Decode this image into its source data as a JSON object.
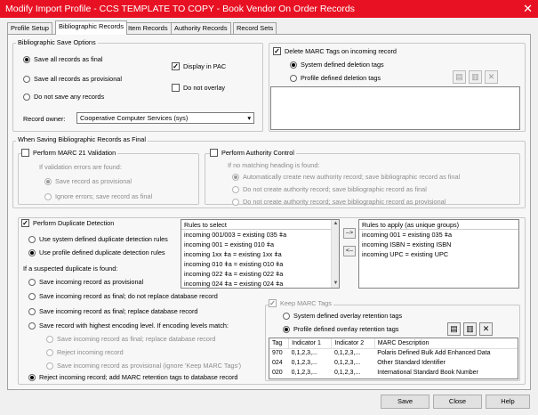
{
  "window": {
    "title": "Modify Import Profile - CCS TEMPLATE TO COPY - Book Vendor On Order Records",
    "close": "✕"
  },
  "tabs": [
    "Profile Setup",
    "Bibliographic Records",
    "Item Records",
    "Authority Records",
    "Record Sets"
  ],
  "save_options": {
    "legend": "Bibliographic Save Options",
    "opt_final": "Save all records as final",
    "opt_prov": "Save all records as provisional",
    "opt_none": "Do not save any records",
    "display_pac": "Display in PAC",
    "no_overlay": "Do not overlay",
    "owner_label": "Record owner:",
    "owner_value": "Cooperative Computer Services (sys)"
  },
  "delete_marc": {
    "label": "Delete MARC Tags on incoming record",
    "sys": "System defined deletion tags",
    "prof": "Profile defined deletion tags"
  },
  "final_section": {
    "legend": "When Saving Bibliographic Records as Final"
  },
  "marc21": {
    "label": "Perform MARC 21 Validation",
    "if_errors": "If validation errors are found:",
    "save_prov": "Save record as provisional",
    "ignore": "Ignore errors; save record as final"
  },
  "authority": {
    "label": "Perform Authority Control",
    "if_none": "If no matching heading is found:",
    "auto": "Automatically create new authority record; save bibliographic record as final",
    "no_final": "Do not create authority record; save bibliographic record as final",
    "no_prov": "Do not create authority record; save bibliographic record as provisional"
  },
  "dup": {
    "label": "Perform Duplicate Detection",
    "sys_rules": "Use system defined duplicate detection rules",
    "prof_rules": "Use profile defined duplicate detection rules",
    "if_dup": "If a suspected duplicate is found:",
    "o1": "Save incoming record as provisional",
    "o2": "Save incoming record as final; do not replace database record",
    "o3": "Save incoming record as final; replace database record",
    "o4": "Save record with highest encoding level. If encoding levels match:",
    "o4a": "Save incoming record as final; replace database record",
    "o4b": "Reject incoming record",
    "o4c": "Save incoming record as provisional (ignore 'Keep MARC Tags')",
    "o5": "Reject incoming record; add MARC retention tags to database record"
  },
  "rules_select": {
    "header": "Rules to select",
    "items": [
      "incoming 001/003 = existing 035 ǂa",
      "incoming 001 = existing 010 ǂa",
      "incoming 1xx ǂa = existing 1xx ǂa",
      "incoming 010 ǂa = existing 010 ǂa",
      "incoming 022 ǂa = existing 022 ǂa",
      "incoming 024 ǂa = existing 024 ǂa"
    ]
  },
  "rules_apply": {
    "header": "Rules to apply (as unique groups)",
    "items": [
      "incoming 001 = existing 035 ǂa",
      "incoming ISBN = existing ISBN",
      "incoming UPC = existing UPC"
    ]
  },
  "move": {
    "right": "-->",
    "left": "<--"
  },
  "keep_marc": {
    "label": "Keep MARC Tags",
    "sys": "System defined overlay retention tags",
    "prof": "Profile defined overlay retention tags"
  },
  "marc_table": {
    "headers": [
      "Tag",
      "Indicator 1",
      "Indicator 2",
      "MARC Description"
    ],
    "rows": [
      [
        "970",
        "0,1,2,3,...",
        "0,1,2,3,...",
        "Polaris Defined Bulk Add Enhanced Data"
      ],
      [
        "024",
        "0,1,2,3,...",
        "0,1,2,3,...",
        "Other Standard Identifier"
      ],
      [
        "020",
        "0,1,2,3,...",
        "0,1,2,3,...",
        "International Standard Book Number"
      ]
    ]
  },
  "buttons": {
    "save": "Save",
    "close": "Close",
    "help": "Help"
  },
  "icons": {
    "new": "▤",
    "edit": "▥",
    "delete": "✕"
  }
}
